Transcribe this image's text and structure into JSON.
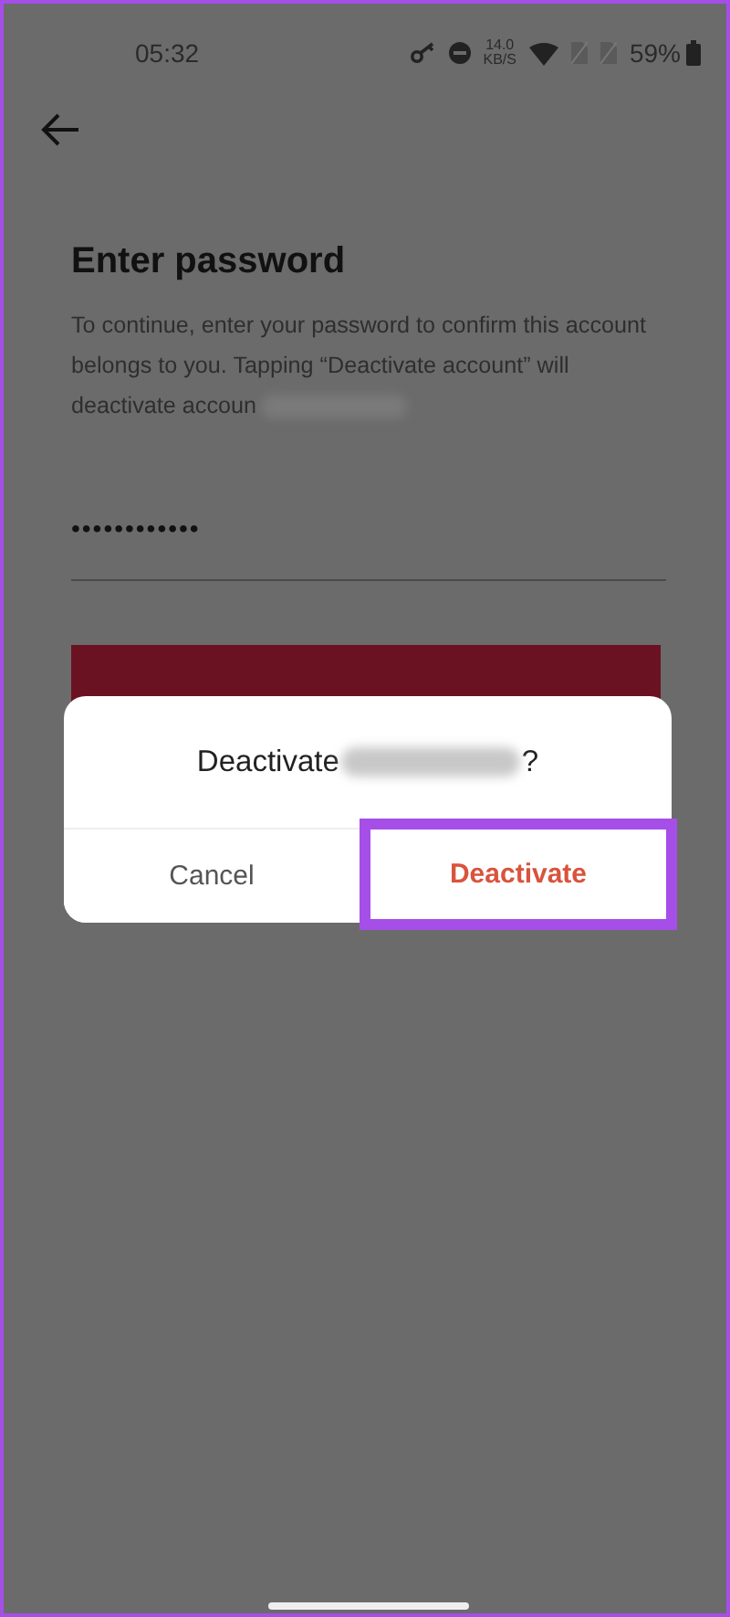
{
  "status_bar": {
    "time": "05:32",
    "net_speed_value": "14.0",
    "net_speed_unit": "KB/S",
    "battery": "59%"
  },
  "page": {
    "title": "Enter password",
    "description": "To continue, enter your password to confirm this account belongs to you. Tapping “Deactivate account” will deactivate accoun",
    "password_value": "••••••••••••",
    "description_redacted": true
  },
  "dialog": {
    "title_before": "Deactivate",
    "title_after": "?",
    "title_redacted": true,
    "buttons": [
      {
        "label": "Cancel",
        "kind": "cancel",
        "highlighted": false
      },
      {
        "label": "Deactivate",
        "kind": "destructive",
        "highlighted": true
      }
    ]
  }
}
